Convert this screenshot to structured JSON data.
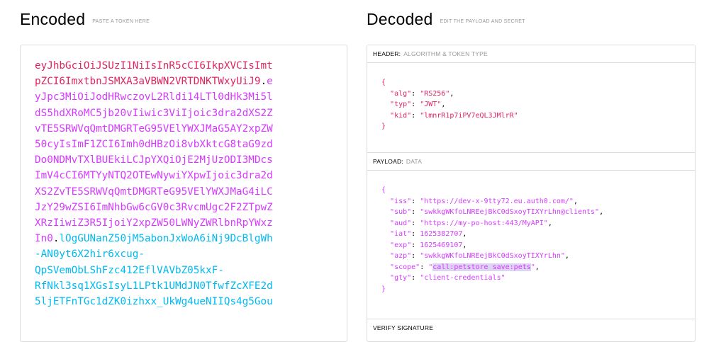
{
  "encoded": {
    "title": "Encoded",
    "subtitle": "PASTE A TOKEN HERE",
    "lines": [
      [
        {
          "t": "h",
          "v": "eyJhbGciOiJSUzI1NiIsInR5cCI6IkpXVCIsImt"
        }
      ],
      [
        {
          "t": "h",
          "v": "pZCI6ImxtbnJSMXA3aVBWN2VRTDNKTWxyUiJ9"
        },
        {
          "t": "dot",
          "v": "."
        },
        {
          "t": "p",
          "v": "e"
        }
      ],
      [
        {
          "t": "p",
          "v": "yJpc3MiOiJodHRwczovL2Rldi14LTl0dHk3Mi5l"
        }
      ],
      [
        {
          "t": "p",
          "v": "dS5hdXRoMC5jb20vIiwic3ViIjoic3dra2dXS2Z"
        }
      ],
      [
        {
          "t": "p",
          "v": "vTE5SRWVqQmtDMGRTeG95VElYWXJMaG5AY2xpZW"
        }
      ],
      [
        {
          "t": "p",
          "v": "50cyIsImF1ZCI6Imh0dHBzOi8vbXktcG8taG9zd"
        }
      ],
      [
        {
          "t": "p",
          "v": "Do0NDMvTXlBUEkiLCJpYXQiOjE2MjUzODI3MDcs"
        }
      ],
      [
        {
          "t": "p",
          "v": "ImV4cCI6MTYyNTQ2OTEwNywiYXpwIjoic3dra2d"
        }
      ],
      [
        {
          "t": "p",
          "v": "XS2ZvTE5SRWVqQmtDMGRTeG95VElYWXJMaG4iLC"
        }
      ],
      [
        {
          "t": "p",
          "v": "JzY29wZSI6ImNhbGw6cGV0c3RvcmUgc2F2ZTpwZ"
        }
      ],
      [
        {
          "t": "p",
          "v": "XRzIiwiZ3R5IjoiY2xpZW50LWNyZWRlbnRpYWxz"
        }
      ],
      [
        {
          "t": "p",
          "v": "In0"
        },
        {
          "t": "dot",
          "v": "."
        },
        {
          "t": "s",
          "v": "lOgGUNanZ50jM5abonJxWoA6iNj9DcBlgWh"
        }
      ],
      [
        {
          "t": "s",
          "v": "-AN0yt6X2hir6xcug-"
        }
      ],
      [
        {
          "t": "s",
          "v": "QpSVemObLShFzc412EflVAVbZ05kxF-"
        }
      ],
      [
        {
          "t": "s",
          "v": "RfNkl3sq1XGsIsyL1LPtk1UMdJN0TfwfZcXFE2d"
        }
      ],
      [
        {
          "t": "s",
          "v": "5ljETFnTGc1dZK0izhxx_UkWg4ueNIIQs4g5Gou"
        }
      ]
    ]
  },
  "decoded": {
    "title": "Decoded",
    "subtitle": "EDIT THE PAYLOAD AND SECRET",
    "header_section": {
      "label": "HEADER:",
      "sublabel": "ALGORITHM & TOKEN TYPE"
    },
    "header_json": [
      {
        "k": "alg",
        "v": "\"RS256\""
      },
      {
        "k": "typ",
        "v": "\"JWT\""
      },
      {
        "k": "kid",
        "v": "\"lmnrR1p7iPV7eQL3JMlrR\""
      }
    ],
    "payload_section": {
      "label": "PAYLOAD:",
      "sublabel": "DATA"
    },
    "payload_json": [
      {
        "k": "iss",
        "v": "\"https://dev-x-9tty72.eu.auth0.com/\""
      },
      {
        "k": "sub",
        "v": "\"swkkgWKfoLNREejBkC0dSxoyTIXYrLhn@clients\""
      },
      {
        "k": "aud",
        "v": "\"https://my-po-host:443/MyAPI\""
      },
      {
        "k": "iat",
        "v": "1625382707"
      },
      {
        "k": "exp",
        "v": "1625469107"
      },
      {
        "k": "azp",
        "v": "\"swkkgWKfoLNREejBkC0dSxoyTIXYrLhn\""
      },
      {
        "k": "scope",
        "v": "\"call:petstore save:pets\"",
        "hl": "call:petstore save:pets"
      },
      {
        "k": "gty",
        "v": "\"client-credentials\""
      }
    ],
    "verify_section": {
      "label": "VERIFY SIGNATURE"
    }
  }
}
